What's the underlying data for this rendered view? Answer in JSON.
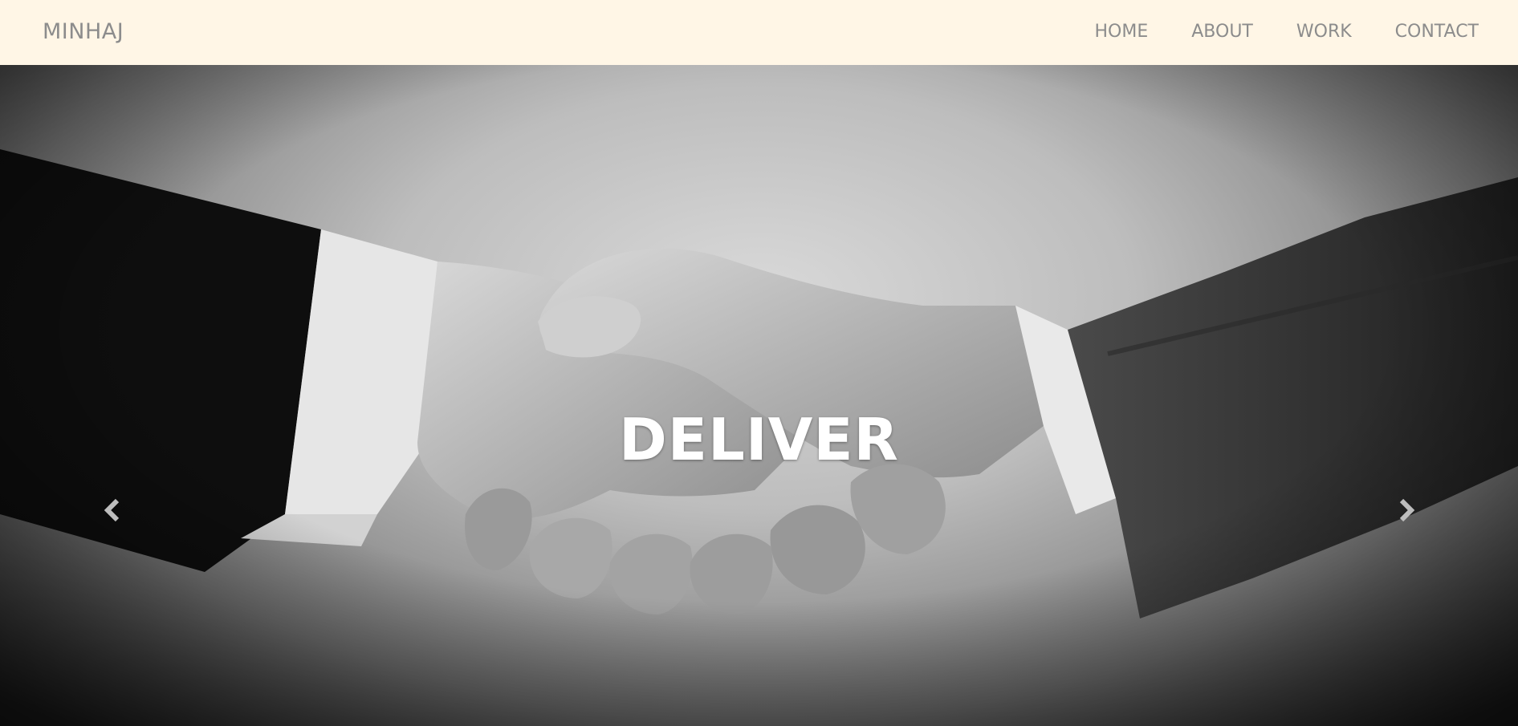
{
  "navbar": {
    "brand": "MINHAJ",
    "links": [
      {
        "label": "HOME"
      },
      {
        "label": "ABOUT"
      },
      {
        "label": "WORK"
      },
      {
        "label": "CONTACT"
      }
    ]
  },
  "carousel": {
    "caption": "DELIVER",
    "prev_icon": "chevron-left-icon",
    "next_icon": "chevron-right-icon"
  },
  "colors": {
    "navbar_bg": "#fff6e6",
    "nav_text": "#8c8c8c",
    "caption_text": "#ffffff"
  }
}
